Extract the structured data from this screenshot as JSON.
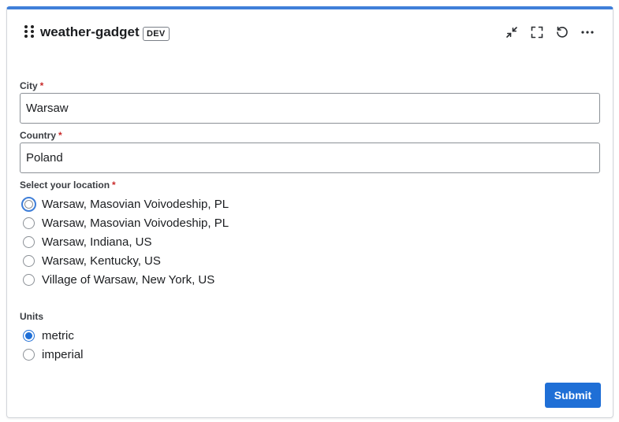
{
  "header": {
    "title": "weather-gadget",
    "badge": "DEV",
    "icons": [
      "minimize-icon",
      "fullscreen-icon",
      "refresh-icon",
      "more-icon"
    ]
  },
  "form": {
    "city": {
      "label": "City",
      "required_mark": "*",
      "value": "Warsaw"
    },
    "country": {
      "label": "Country",
      "required_mark": "*",
      "value": "Poland"
    },
    "location": {
      "label": "Select your location",
      "required_mark": "*",
      "options": [
        "Warsaw, Masovian Voivodeship, PL",
        "Warsaw, Masovian Voivodeship, PL",
        "Warsaw, Indiana, US",
        "Warsaw, Kentucky, US",
        "Village of Warsaw, New York, US"
      ],
      "selected_index": null,
      "focused_index": 0
    },
    "units": {
      "label": "Units",
      "options": [
        "metric",
        "imperial"
      ],
      "selected": "metric"
    },
    "submit_label": "Submit"
  },
  "colors": {
    "accent": "#3f7fd9",
    "primary_button": "#1f6fd6",
    "required": "#c92a2a"
  }
}
